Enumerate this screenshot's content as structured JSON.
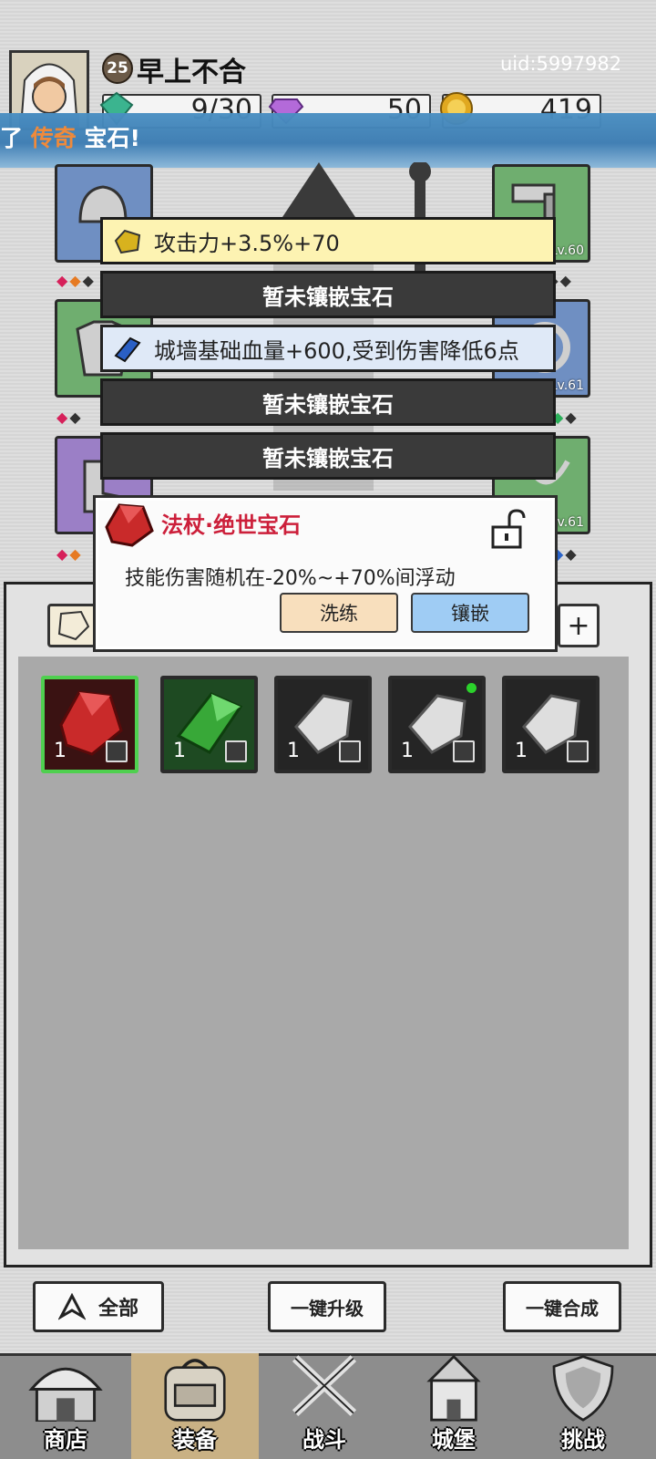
{
  "header": {
    "player_level": "25",
    "player_name": "早上不合",
    "uid": "uid:5997982",
    "resources": [
      {
        "name": "stamina",
        "icon": "green-gem-icon",
        "value": "9/30",
        "color": "#3bb48f"
      },
      {
        "name": "diamond",
        "icon": "purple-diamond-icon",
        "value": "50",
        "color": "#b36ad9"
      },
      {
        "name": "gold",
        "icon": "gold-coin-icon",
        "value": "419",
        "color": "#e0a820"
      }
    ]
  },
  "banner": {
    "prefix": "了",
    "highlight": "传奇",
    "suffix": "宝石!"
  },
  "slots": {
    "right_levels": [
      "Lv.60",
      "Lv.61",
      "Lv.61"
    ]
  },
  "gem_sockets": [
    {
      "text": "攻击力+3.5%+70",
      "state": "filled",
      "gem": "yellow-gem-icon"
    },
    {
      "text": "暂未镶嵌宝石",
      "state": "empty"
    },
    {
      "text": "城墙基础血量+600,受到伤害降低6点",
      "state": "filled",
      "gem": "blue-gem-icon"
    },
    {
      "text": "暂未镶嵌宝石",
      "state": "empty"
    },
    {
      "text": "暂未镶嵌宝石",
      "state": "empty"
    }
  ],
  "popup": {
    "gem_name": "法杖·绝世宝石",
    "description": "技能伤害随机在-20%~+70%间浮动",
    "reroll_label": "洗练",
    "inlay_label": "镶嵌"
  },
  "inventory": [
    {
      "count": "1",
      "gem": "red-gem-icon",
      "type": "staff-icon",
      "selected": true
    },
    {
      "count": "1",
      "gem": "green-gem-icon",
      "type": "armor-icon",
      "selected": false
    },
    {
      "count": "1",
      "gem": "white-stone-icon",
      "type": "boots-icon",
      "selected": false
    },
    {
      "count": "1",
      "gem": "white-stone-icon",
      "type": "helmet-icon",
      "selected": false,
      "dot": true
    },
    {
      "count": "1",
      "gem": "white-stone-icon",
      "type": "ring-icon",
      "selected": false
    }
  ],
  "actions": {
    "filter_label": "全部",
    "upgrade_all_label": "一键升级",
    "merge_all_label": "一键合成"
  },
  "nav": [
    {
      "label": "商店",
      "icon": "shop-icon",
      "active": false
    },
    {
      "label": "装备",
      "icon": "backpack-icon",
      "active": true
    },
    {
      "label": "战斗",
      "icon": "crossed-swords-icon",
      "active": false
    },
    {
      "label": "城堡",
      "icon": "castle-icon",
      "active": false
    },
    {
      "label": "挑战",
      "icon": "shield-icon",
      "active": false
    }
  ]
}
